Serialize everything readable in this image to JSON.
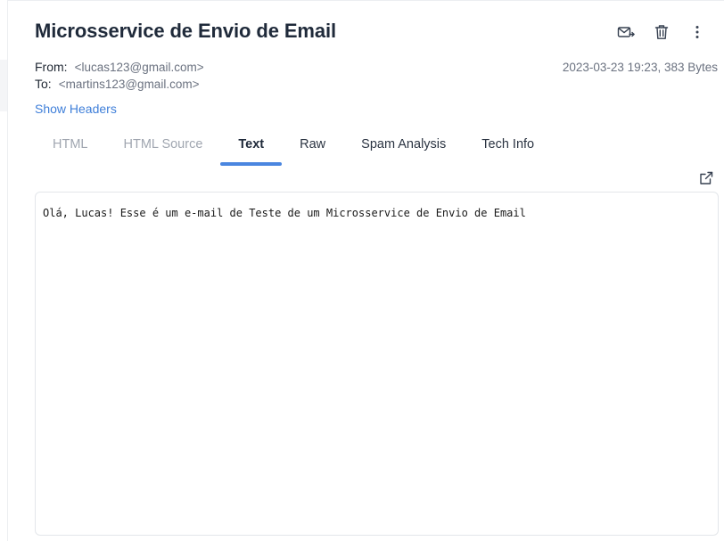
{
  "email": {
    "subject": "Microsservice de Envio de Email",
    "from_label": "From:",
    "from_value": "<lucas123@gmail.com>",
    "to_label": "To:",
    "to_value": "<martins123@gmail.com>",
    "date_size": "2023-03-23 19:23, 383 Bytes",
    "show_headers": "Show Headers"
  },
  "toolbar": {
    "icons": [
      "forward-email-icon",
      "trash-icon",
      "more-vertical-icon"
    ]
  },
  "tabs": [
    {
      "label": "HTML",
      "active": false
    },
    {
      "label": "HTML Source",
      "active": false
    },
    {
      "label": "Text",
      "active": true
    },
    {
      "label": "Raw",
      "active": false
    },
    {
      "label": "Spam Analysis",
      "active": false
    },
    {
      "label": "Tech Info",
      "active": false
    }
  ],
  "body": {
    "text": "Olá, Lucas! Esse é um e-mail de Teste de um Microsservice de Envio de Email"
  },
  "colors": {
    "accent": "#4a86e0",
    "link": "#3f7fd9",
    "muted": "#6b7280"
  }
}
